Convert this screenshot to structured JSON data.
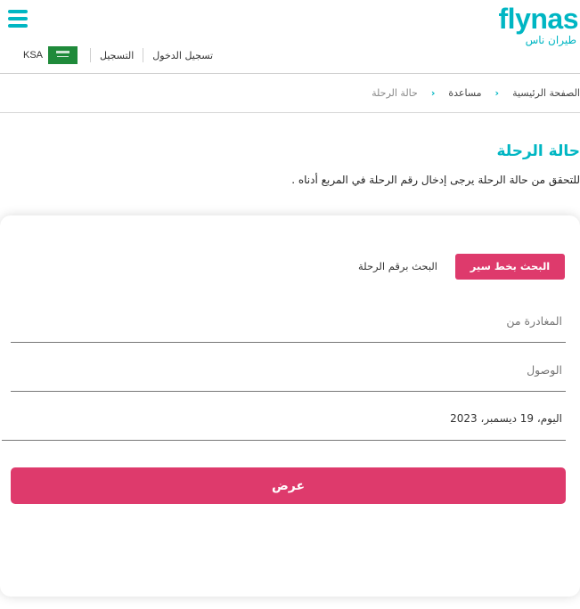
{
  "brand": {
    "name_en": "flynas",
    "name_ar": "طيران ناس",
    "color": "#00b6c3",
    "accent": "#de3a6c"
  },
  "header": {
    "menu_icon": "hamburger-menu-icon",
    "links": {
      "login": "تسجيل الدخول",
      "register": "التسجيل"
    },
    "country": {
      "code": "KSA",
      "flag": "saudi-flag-icon"
    }
  },
  "breadcrumb": {
    "items": [
      "الصفحة الرئيسية",
      "مساعدة",
      "حالة الرحلة"
    ],
    "separator_icon": "chevron-icon"
  },
  "page": {
    "title": "حالة الرحلة",
    "description": "للتحقق من حالة الرحلة يرجى إدخال رقم الرحلة في المربع أدناه ."
  },
  "search": {
    "tabs": {
      "by_route": "البحث بخط سير الرحلة",
      "by_flight_number": "البحث برقم الرحلة"
    },
    "from_placeholder": "المغادرة من",
    "to_placeholder": "الوصول",
    "date_value": "اليوم، 19 ديسمبر، 2023",
    "submit_label": "عرض"
  }
}
